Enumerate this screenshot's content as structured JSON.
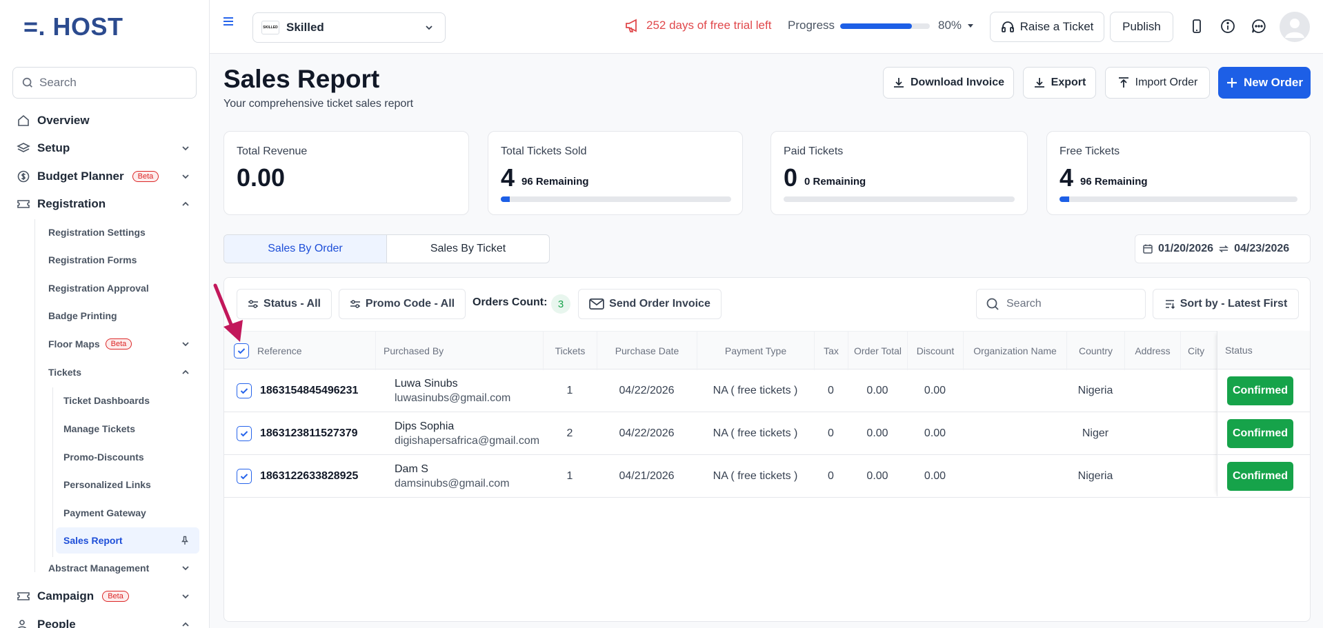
{
  "brand": {
    "logo": "=. HOST"
  },
  "sidebar": {
    "search_placeholder": "Search",
    "items": [
      {
        "label": "Overview",
        "icon": "home-icon"
      },
      {
        "label": "Setup",
        "icon": "layers-icon"
      },
      {
        "label": "Budget Planner",
        "icon": "dollar-icon",
        "badge": "Beta"
      },
      {
        "label": "Registration",
        "icon": "ticket-icon"
      },
      {
        "label": "Campaign",
        "icon": "ticket-icon",
        "badge": "Beta"
      },
      {
        "label": "People",
        "icon": "people-icon"
      }
    ],
    "registration_sub": [
      {
        "label": "Registration Settings"
      },
      {
        "label": "Registration Forms"
      },
      {
        "label": "Registration Approval"
      },
      {
        "label": "Badge Printing"
      },
      {
        "label": "Floor Maps",
        "badge": "Beta"
      },
      {
        "label": "Tickets"
      },
      {
        "label": "Abstract Management"
      }
    ],
    "tickets_sub": [
      {
        "label": "Ticket Dashboards"
      },
      {
        "label": "Manage Tickets"
      },
      {
        "label": "Promo-Discounts"
      },
      {
        "label": "Personalized Links"
      },
      {
        "label": "Payment Gateway"
      },
      {
        "label": "Sales Report",
        "active": true
      }
    ]
  },
  "topbar": {
    "event_name": "Skilled",
    "event_thumb": "SKILLED",
    "trial_text": "252 days of free trial left",
    "progress_label": "Progress",
    "progress_value": 0.8,
    "progress_pct": "80%",
    "raise_ticket": "Raise a Ticket",
    "publish": "Publish"
  },
  "page": {
    "title": "Sales Report",
    "subtitle": "Your comprehensive ticket sales report",
    "buttons": {
      "download_invoice": "Download Invoice",
      "export": "Export",
      "import_order": "Import Order",
      "new_order": "New Order"
    }
  },
  "stats": [
    {
      "title": "Total Revenue",
      "value": "0.00"
    },
    {
      "title": "Total Tickets Sold",
      "value": "4",
      "remaining": "96 Remaining",
      "fill": 0.04
    },
    {
      "title": "Paid Tickets",
      "value": "0",
      "remaining": "0 Remaining",
      "fill": 0
    },
    {
      "title": "Free Tickets",
      "value": "4",
      "remaining": "96 Remaining",
      "fill": 0.04
    }
  ],
  "tabs": {
    "by_order": "Sales By Order",
    "by_ticket": "Sales By Ticket"
  },
  "date_range": {
    "start": "01/20/2026",
    "end": "04/23/2026"
  },
  "toolbar": {
    "status_filter": "Status - All",
    "promo_filter": "Promo Code - All",
    "orders_count_label": "Orders Count:",
    "orders_count": "3",
    "send_invoice": "Send Order Invoice",
    "search_placeholder": "Search",
    "sort": "Sort by - Latest First"
  },
  "table": {
    "columns": [
      "Reference",
      "Purchased By",
      "Tickets",
      "Purchase Date",
      "Payment Type",
      "Tax",
      "Order Total",
      "Discount",
      "Organization Name",
      "Country",
      "Address",
      "City",
      "Status"
    ],
    "rows": [
      {
        "reference": "1863154845496231",
        "name": "Luwa Sinubs",
        "email": "luwasinubs@gmail.com",
        "tickets": "1",
        "date": "04/22/2026",
        "payment": "NA ( free tickets )",
        "tax": "0",
        "total": "0.00",
        "discount": "0.00",
        "org": "",
        "country": "Nigeria",
        "address": "",
        "city": "",
        "status": "Confirmed"
      },
      {
        "reference": "1863123811527379",
        "name": "Dips Sophia",
        "email": "digishapersafrica@gmail.com",
        "tickets": "2",
        "date": "04/22/2026",
        "payment": "NA ( free tickets )",
        "tax": "0",
        "total": "0.00",
        "discount": "0.00",
        "org": "",
        "country": "Niger",
        "address": "",
        "city": "",
        "status": "Confirmed"
      },
      {
        "reference": "1863122633828925",
        "name": "Dam S",
        "email": "damsinubs@gmail.com",
        "tickets": "1",
        "date": "04/21/2026",
        "payment": "NA ( free tickets )",
        "tax": "0",
        "total": "0.00",
        "discount": "0.00",
        "org": "",
        "country": "Nigeria",
        "address": "",
        "city": "",
        "status": "Confirmed"
      }
    ]
  },
  "colors": {
    "accent": "#1d5fe6",
    "success": "#16a34a",
    "trial": "#e0484b",
    "annotation": "#c2185b"
  }
}
